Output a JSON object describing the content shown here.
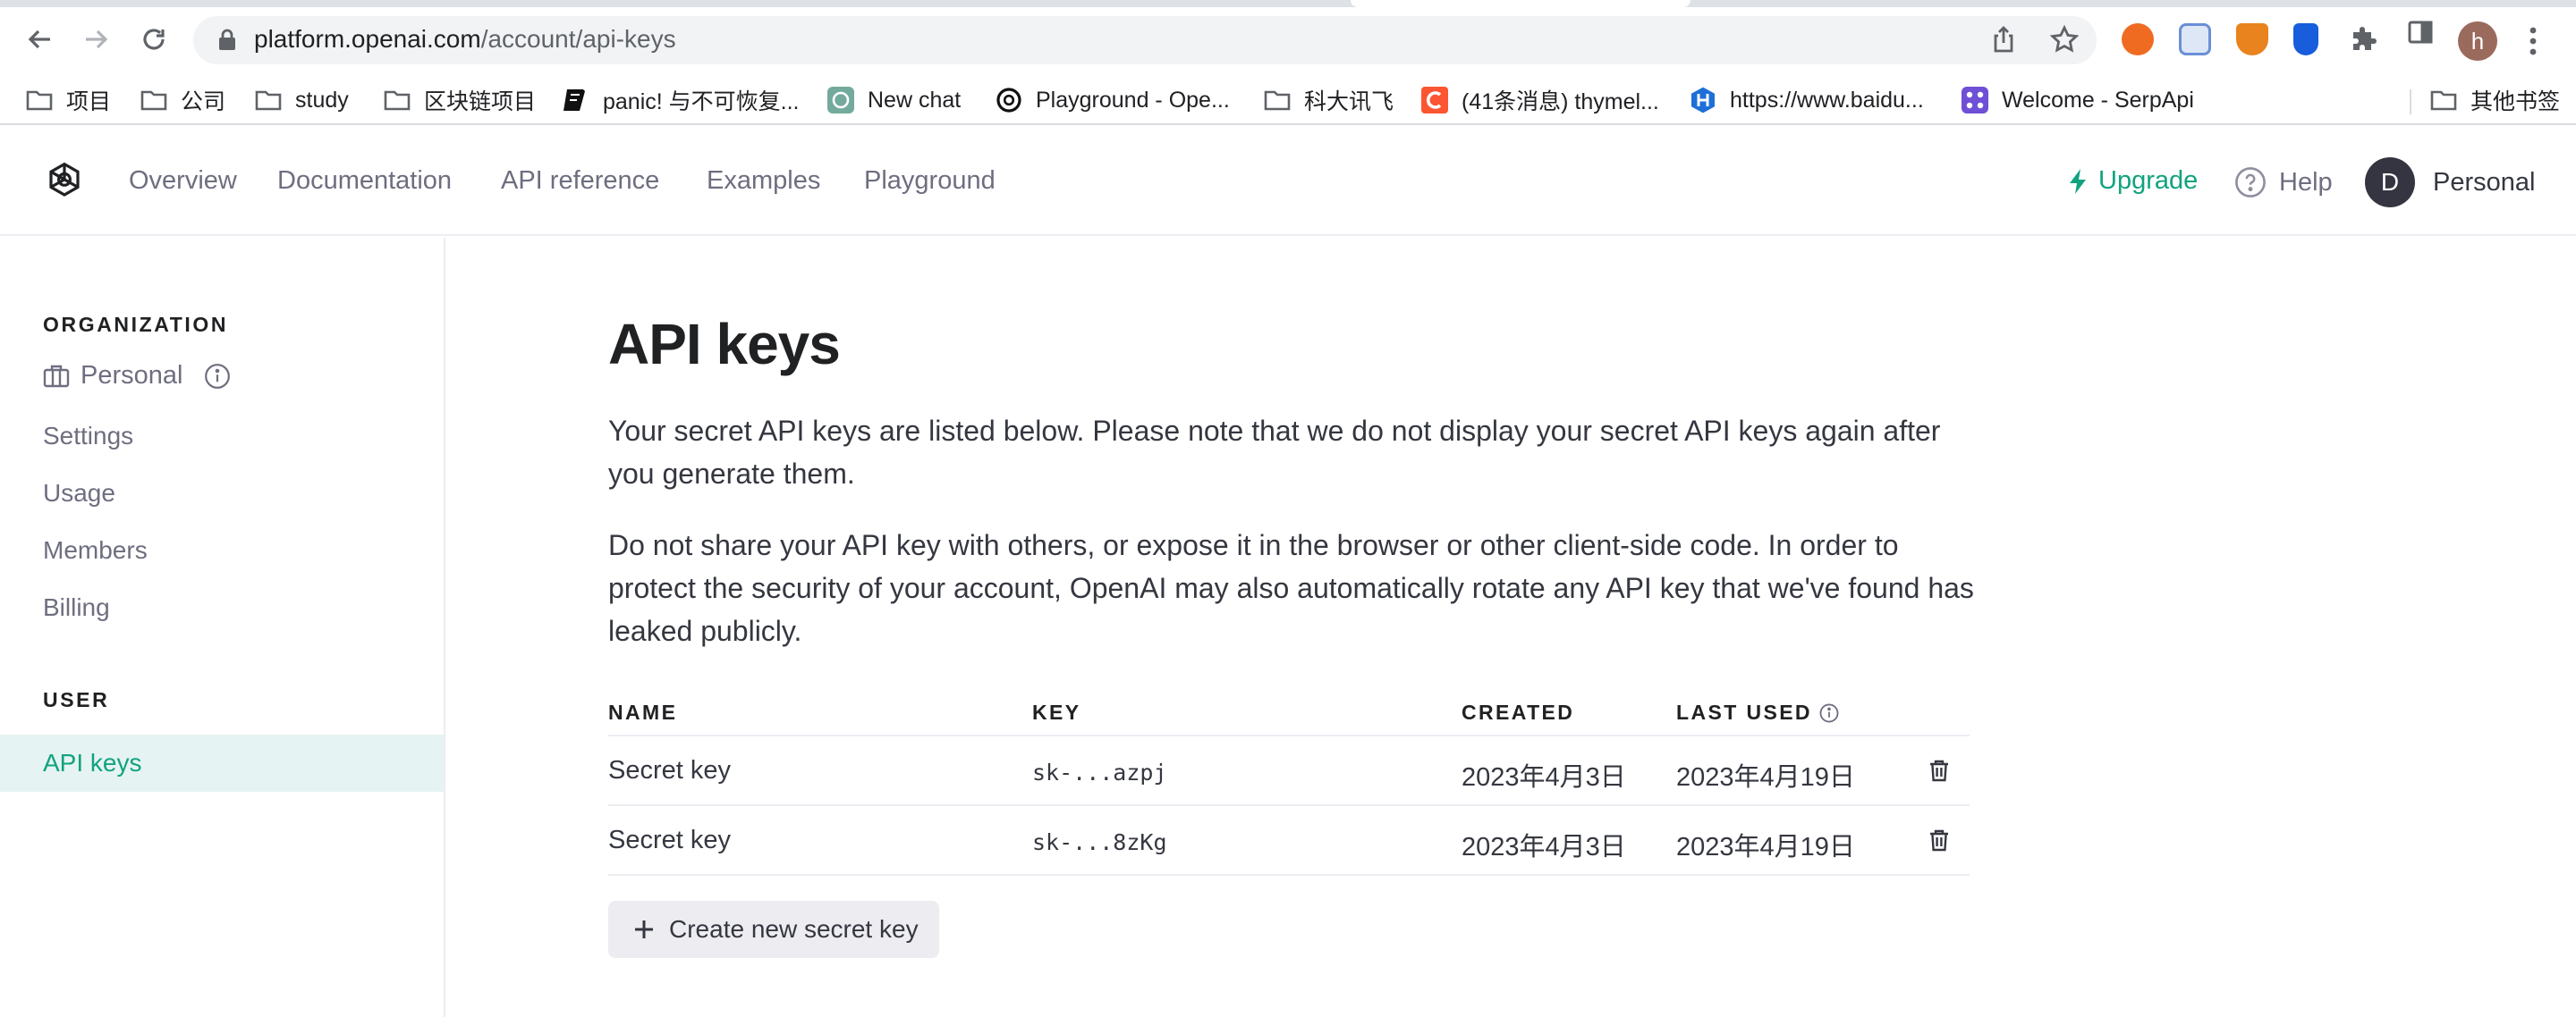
{
  "browser": {
    "url_host": "platform.openai.com",
    "url_path": "/account/api-keys",
    "profile_initial": "h",
    "bookmarks": [
      {
        "label": "项目",
        "icon": "folder-icon"
      },
      {
        "label": "公司",
        "icon": "folder-icon"
      },
      {
        "label": "study",
        "icon": "folder-icon"
      },
      {
        "label": "区块链项目",
        "icon": "folder-icon"
      },
      {
        "label": "panic! 与不可恢复...",
        "icon": "rust-book-icon"
      },
      {
        "label": "New chat",
        "icon": "chatgpt-icon"
      },
      {
        "label": "Playground - Ope...",
        "icon": "openai-icon"
      },
      {
        "label": "科大讯飞",
        "icon": "folder-icon"
      },
      {
        "label": "(41条消息) thymel...",
        "icon": "csdn-icon"
      },
      {
        "label": "https://www.baidu...",
        "icon": "hexagon-h-icon"
      },
      {
        "label": "Welcome - SerpApi",
        "icon": "serpapi-icon"
      },
      {
        "label": "其他书签",
        "icon": "folder-icon"
      }
    ]
  },
  "header": {
    "nav": [
      "Overview",
      "Documentation",
      "API reference",
      "Examples",
      "Playground"
    ],
    "upgrade": "Upgrade",
    "help": "Help",
    "avatar_initial": "D",
    "account_name": "Personal"
  },
  "sidebar": {
    "org_title": "ORGANIZATION",
    "org_name": "Personal",
    "org_links": [
      "Settings",
      "Usage",
      "Members",
      "Billing"
    ],
    "user_title": "USER",
    "user_active": "API keys"
  },
  "main": {
    "title": "API keys",
    "paragraph1": "Your secret API keys are listed below. Please note that we do not display your secret API keys again after you generate them.",
    "paragraph2": "Do not share your API key with others, or expose it in the browser or other client-side code. In order to protect the security of your account, OpenAI may also automatically rotate any API key that we've found has leaked publicly.",
    "columns": {
      "name": "NAME",
      "key": "KEY",
      "created": "CREATED",
      "last_used": "LAST USED"
    },
    "rows": [
      {
        "name": "Secret key",
        "key": "sk-...azpj",
        "created": "2023年4月3日",
        "last_used": "2023年4月19日"
      },
      {
        "name": "Secret key",
        "key": "sk-...8zKg",
        "created": "2023年4月3日",
        "last_used": "2023年4月19日"
      }
    ],
    "create_button": "Create new secret key"
  },
  "colors": {
    "accent": "#10a37f",
    "text": "#202123",
    "muted": "#6e6e80",
    "border": "#ececf1",
    "active_bg": "#e6f3f3"
  }
}
